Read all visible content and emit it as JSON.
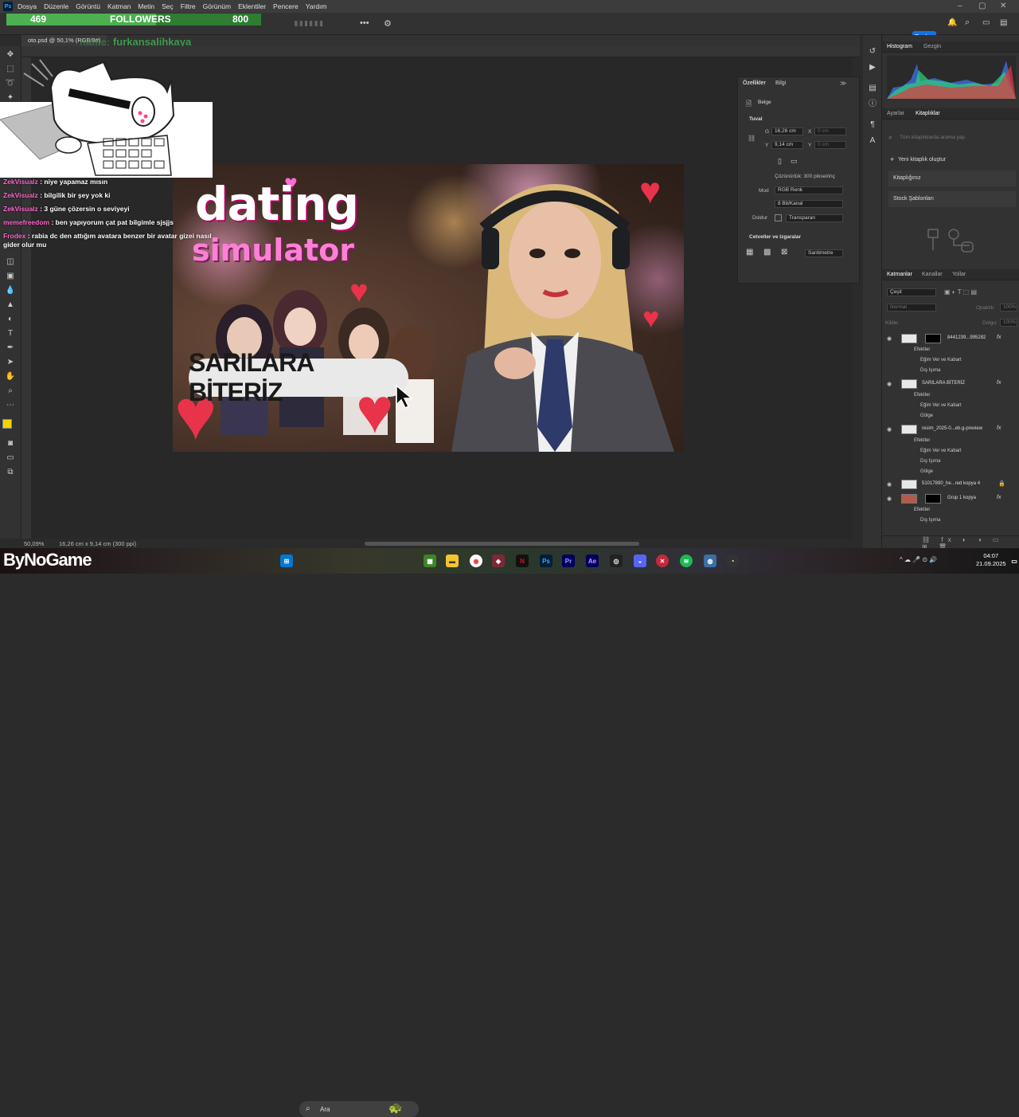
{
  "menubar": {
    "app_icon": "Ps",
    "items": [
      "Dosya",
      "Düzenle",
      "Görüntü",
      "Katman",
      "Metin",
      "Seç",
      "Filtre",
      "Görünüm",
      "Eklentiler",
      "Pencere",
      "Yardım"
    ]
  },
  "overlay": {
    "follower_count": "469",
    "followers_label": "FOLLOWERS",
    "follower_goal": "800",
    "follower_progress": 0.586,
    "streamer_prefix": "name:",
    "streamer_name": "furkansalihkaya"
  },
  "options_bar": {
    "share_label": "Paylaş"
  },
  "document": {
    "tab_label": "oto.psd @ 50,1% (RGB/8#)",
    "zoom": "50,09%",
    "doc_info": "16,26 cm x 9,14 cm (300 ppi)"
  },
  "artwork": {
    "title_line1": "dating",
    "title_line2": "simulator",
    "caption": "SARILARA BİTERİZ"
  },
  "chat": [
    {
      "user": "ZekVisualz",
      "message": ": niye yapamaz mısın"
    },
    {
      "user": "ZekVisualz",
      "message": ": bilgilik bir şey yok ki"
    },
    {
      "user": "ZekVisualz",
      "message": ": 3 güne çözersin o seviyeyi"
    },
    {
      "user": "memefreedom",
      "message": ": ben yapıyorum çat pat bilgimle sjsjjs"
    },
    {
      "user": "Frodex",
      "message": ": rabia dc den attığım avatara benzer bir avatar gizei nasıl gider olur mu"
    }
  ],
  "properties": {
    "tabs": [
      "Özellikler",
      "Bilgi"
    ],
    "doc_label": "Belge",
    "canvas_section": "Tuval",
    "w_label": "G",
    "w_value": "16,26 cm",
    "x_label": "X",
    "x_value": "0 cm",
    "h_label": "Y",
    "h_value": "9,14 cm",
    "y_label": "Y",
    "y_value": "0 cm",
    "resolution": "Çözünürlük: 300 piksel/inç",
    "mode_label": "Mod",
    "mode_value": "RGB Renk",
    "depth_value": "8 Bit/Kanal",
    "fill_label": "Doldur",
    "fill_value": "Transparan",
    "rulers_section": "Cetveller ve Izgaralar",
    "units_value": "Santimetre"
  },
  "right_panel": {
    "histogram_tabs": [
      "Histogram",
      "Gezgin"
    ],
    "library_tabs": [
      "Ayarlar",
      "Kitaplıklar"
    ],
    "library_search": "Tüm kitaplıklarda arama yap",
    "new_library": "Yeni kitaplık oluştur",
    "my_libraries": "Kitaplığınız",
    "stock_templates": "Stock Şablonları",
    "layers_tabs": [
      "Katmanlar",
      "Kanallar",
      "Yollar"
    ],
    "layer_kind": "Çeşit",
    "blend_mode": "Normal",
    "opacity_label": "Opaklık:",
    "opacity_value": "100%",
    "lock_label": "Kilitle:",
    "fill_label": "Dolgu:",
    "fill_value": "100%",
    "layers": [
      {
        "name": "8441239...995282",
        "effects": [
          "Efektler",
          "Eğim Ver ve Kabart",
          "Dış Işıma"
        ]
      },
      {
        "name": "SARILARA BİTERİZ",
        "effects": [
          "Efektler",
          "Eğim Ver ve Kabart",
          "Gölge"
        ]
      },
      {
        "name": "resim_2025-0...eb.g-preview",
        "effects": [
          "Efektler",
          "Eğim Ver ve Kabart",
          "Dış Işıma",
          "Gölge"
        ]
      },
      {
        "name": "51017890_he...red kopya 4",
        "effects": []
      },
      {
        "name": "Grup 1 kopya",
        "effects": [
          "Efektler",
          "Dış Işıma"
        ]
      }
    ]
  },
  "taskbar": {
    "brand": "ByNoGame",
    "search_placeholder": "Ara",
    "time": "04:07",
    "date": "21.09.2025"
  },
  "colors": {
    "accent_blue": "#1473e6",
    "follow_green": "#4caf50",
    "heart_red": "#e8334a",
    "title_pink": "#ff7fd6",
    "chat_user": "#ff66cc"
  }
}
